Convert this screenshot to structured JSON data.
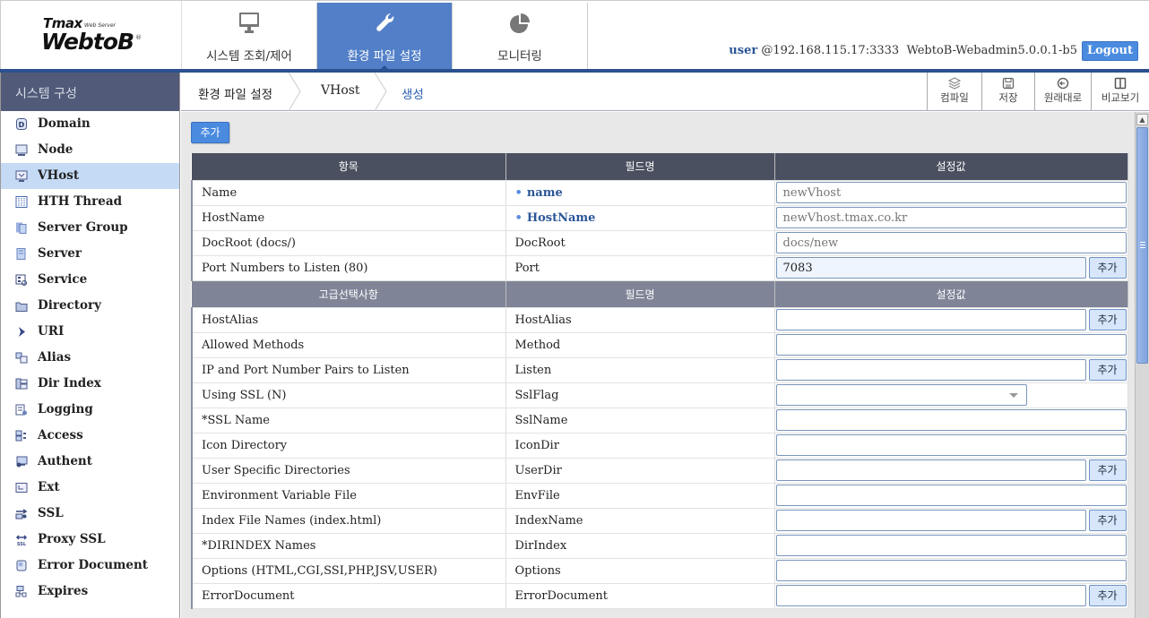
{
  "logo": {
    "brand_small": "Tmax",
    "subtitle": "Web Server",
    "brand": "WebtoB",
    "registered": "®"
  },
  "topnav": [
    {
      "label": "시스템 조회/제어",
      "icon": "monitor-icon",
      "active": false
    },
    {
      "label": "환경 파일 설정",
      "icon": "wrench-icon",
      "active": true
    },
    {
      "label": "모니터링",
      "icon": "pie-chart-icon",
      "active": false
    }
  ],
  "user": {
    "name": "user",
    "host": "@192.168.115.17:3333",
    "version": "WebtoB-Webadmin5.0.0.1-b5",
    "logout_label": "Logout"
  },
  "sidebar": {
    "title": "시스템 구성",
    "items": [
      {
        "label": "Domain",
        "icon": "domain-icon"
      },
      {
        "label": "Node",
        "icon": "node-icon"
      },
      {
        "label": "VHost",
        "icon": "vhost-icon",
        "active": true
      },
      {
        "label": "HTH Thread",
        "icon": "thread-icon"
      },
      {
        "label": "Server Group",
        "icon": "server-group-icon"
      },
      {
        "label": "Server",
        "icon": "server-icon"
      },
      {
        "label": "Service",
        "icon": "service-icon"
      },
      {
        "label": "Directory",
        "icon": "folder-icon"
      },
      {
        "label": "URI",
        "icon": "uri-icon"
      },
      {
        "label": "Alias",
        "icon": "alias-icon"
      },
      {
        "label": "Dir Index",
        "icon": "dir-index-icon"
      },
      {
        "label": "Logging",
        "icon": "logging-icon"
      },
      {
        "label": "Access",
        "icon": "access-icon"
      },
      {
        "label": "Authent",
        "icon": "authent-icon"
      },
      {
        "label": "Ext",
        "icon": "ext-icon"
      },
      {
        "label": "SSL",
        "icon": "ssl-icon"
      },
      {
        "label": "Proxy SSL",
        "icon": "proxy-ssl-icon"
      },
      {
        "label": "Error Document",
        "icon": "error-document-icon"
      },
      {
        "label": "Expires",
        "icon": "expires-icon"
      }
    ]
  },
  "breadcrumb": [
    "환경 파일 설정",
    "VHost",
    "생성"
  ],
  "toolbar": {
    "compile": "컴파일",
    "save": "저장",
    "revert": "원래대로",
    "compare": "비교보기"
  },
  "content": {
    "add_label": "추가",
    "row_add_label": "추가",
    "header_basic": {
      "item": "항목",
      "field": "필드명",
      "value": "설정값"
    },
    "header_advanced": {
      "item": "고급선택사항",
      "field": "필드명",
      "value": "설정값"
    },
    "basic_rows": [
      {
        "item": "Name",
        "field": "name",
        "required": true,
        "value": "newVhost",
        "placeholder": true,
        "type": "text"
      },
      {
        "item": "HostName",
        "field": "HostName",
        "required": true,
        "value": "newVhost.tmax.co.kr",
        "placeholder": true,
        "type": "text"
      },
      {
        "item": "DocRoot (docs/)",
        "field": "DocRoot",
        "required": false,
        "value": "docs/new",
        "placeholder": true,
        "type": "text"
      },
      {
        "item": "Port Numbers to Listen (80)",
        "field": "Port",
        "required": false,
        "value": "7083",
        "type": "text-add",
        "focused": true
      }
    ],
    "advanced_rows": [
      {
        "item": "HostAlias",
        "field": "HostAlias",
        "value": "",
        "type": "text-add"
      },
      {
        "item": "Allowed Methods",
        "field": "Method",
        "value": "",
        "type": "text"
      },
      {
        "item": "IP and Port Number Pairs to Listen",
        "field": "Listen",
        "value": "",
        "type": "text-add"
      },
      {
        "item": "Using SSL (N)",
        "field": "SslFlag",
        "value": "",
        "type": "select"
      },
      {
        "item": "*SSL Name",
        "field": "SslName",
        "value": "",
        "type": "text"
      },
      {
        "item": "Icon Directory",
        "field": "IconDir",
        "value": "",
        "type": "text"
      },
      {
        "item": "User Specific Directories",
        "field": "UserDir",
        "value": "",
        "type": "text-add"
      },
      {
        "item": "Environment Variable File",
        "field": "EnvFile",
        "value": "",
        "type": "text"
      },
      {
        "item": "Index File Names (index.html)",
        "field": "IndexName",
        "value": "",
        "type": "text-add"
      },
      {
        "item": "*DIRINDEX Names",
        "field": "DirIndex",
        "value": "",
        "type": "text"
      },
      {
        "item": "Options (HTML,CGI,SSI,PHP,JSV,USER)",
        "field": "Options",
        "value": "",
        "type": "text"
      },
      {
        "item": "ErrorDocument",
        "field": "ErrorDocument",
        "value": "",
        "type": "text-add"
      }
    ]
  }
}
